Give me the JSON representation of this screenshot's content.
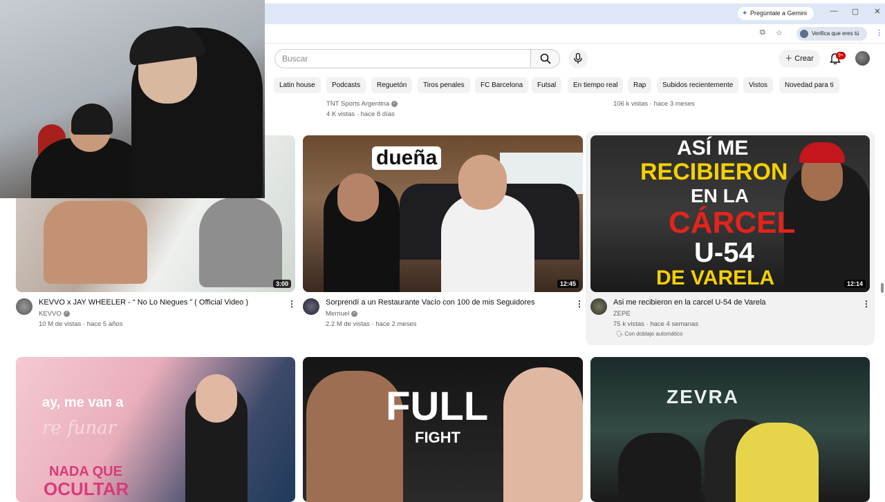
{
  "browser": {
    "gemini_label": "Pregúntale a Gemini",
    "verify_label": "Verifica que eres tú",
    "win_min": "—",
    "win_max": "▢",
    "win_close": "✕"
  },
  "header": {
    "search_placeholder": "Buscar",
    "create_label": "Crear",
    "notif_badge": "9+"
  },
  "chips": [
    "Latin house",
    "Podcasts",
    "Reguetón",
    "Tiros penales",
    "FC Barcelona",
    "Futsal",
    "En tiempo real",
    "Rap",
    "Subidos recientemente",
    "Vistos",
    "Novedad para ti"
  ],
  "prev_row": [
    {
      "channel": "TNT Sports Argentina",
      "stats": "4 K vistas · hace 8 días"
    },
    {
      "stats": "106 k vistas · hace 3 meses"
    }
  ],
  "videos": [
    {
      "title": "KEVVO x JAY WHEELER - “ No Lo Niegues ” ( Official Video )",
      "channel": "KEVVO",
      "stats": "10 M de vistas · hace 5 años",
      "duration": "3:00"
    },
    {
      "title": "Sorprendí a un Restaurante Vacío con 100 de mis Seguidores",
      "channel": "Mernuel",
      "stats": "2.2 M de vistas · hace 2 meses",
      "duration": "12:45",
      "overlay": "dueña"
    },
    {
      "title": "Asi me recibieron en la carcel U-54 de Varela",
      "channel": "ZEPE",
      "stats": "75 k vistas · hace 4 semanas",
      "duration": "12:14",
      "dub": "Con doblaje automático",
      "overlay_lines": [
        "ASÍ ME",
        "RECIBIERON",
        "EN LA",
        "CÁRCEL",
        "U-54",
        "DE VARELA"
      ]
    }
  ],
  "row3": [
    {
      "overlay1": "ay, me van a",
      "overlay2": "re funar",
      "overlay3": "NADA QUE",
      "overlay4": "OCULTAR"
    },
    {
      "overlay1": "FULL",
      "overlay2": "FIGHT"
    },
    {
      "overlay1": "ZEVRA"
    }
  ],
  "colors": {
    "accent": "#cc0000",
    "chip_bg": "#f2f2f2",
    "titlebar": "#dde7f5"
  }
}
